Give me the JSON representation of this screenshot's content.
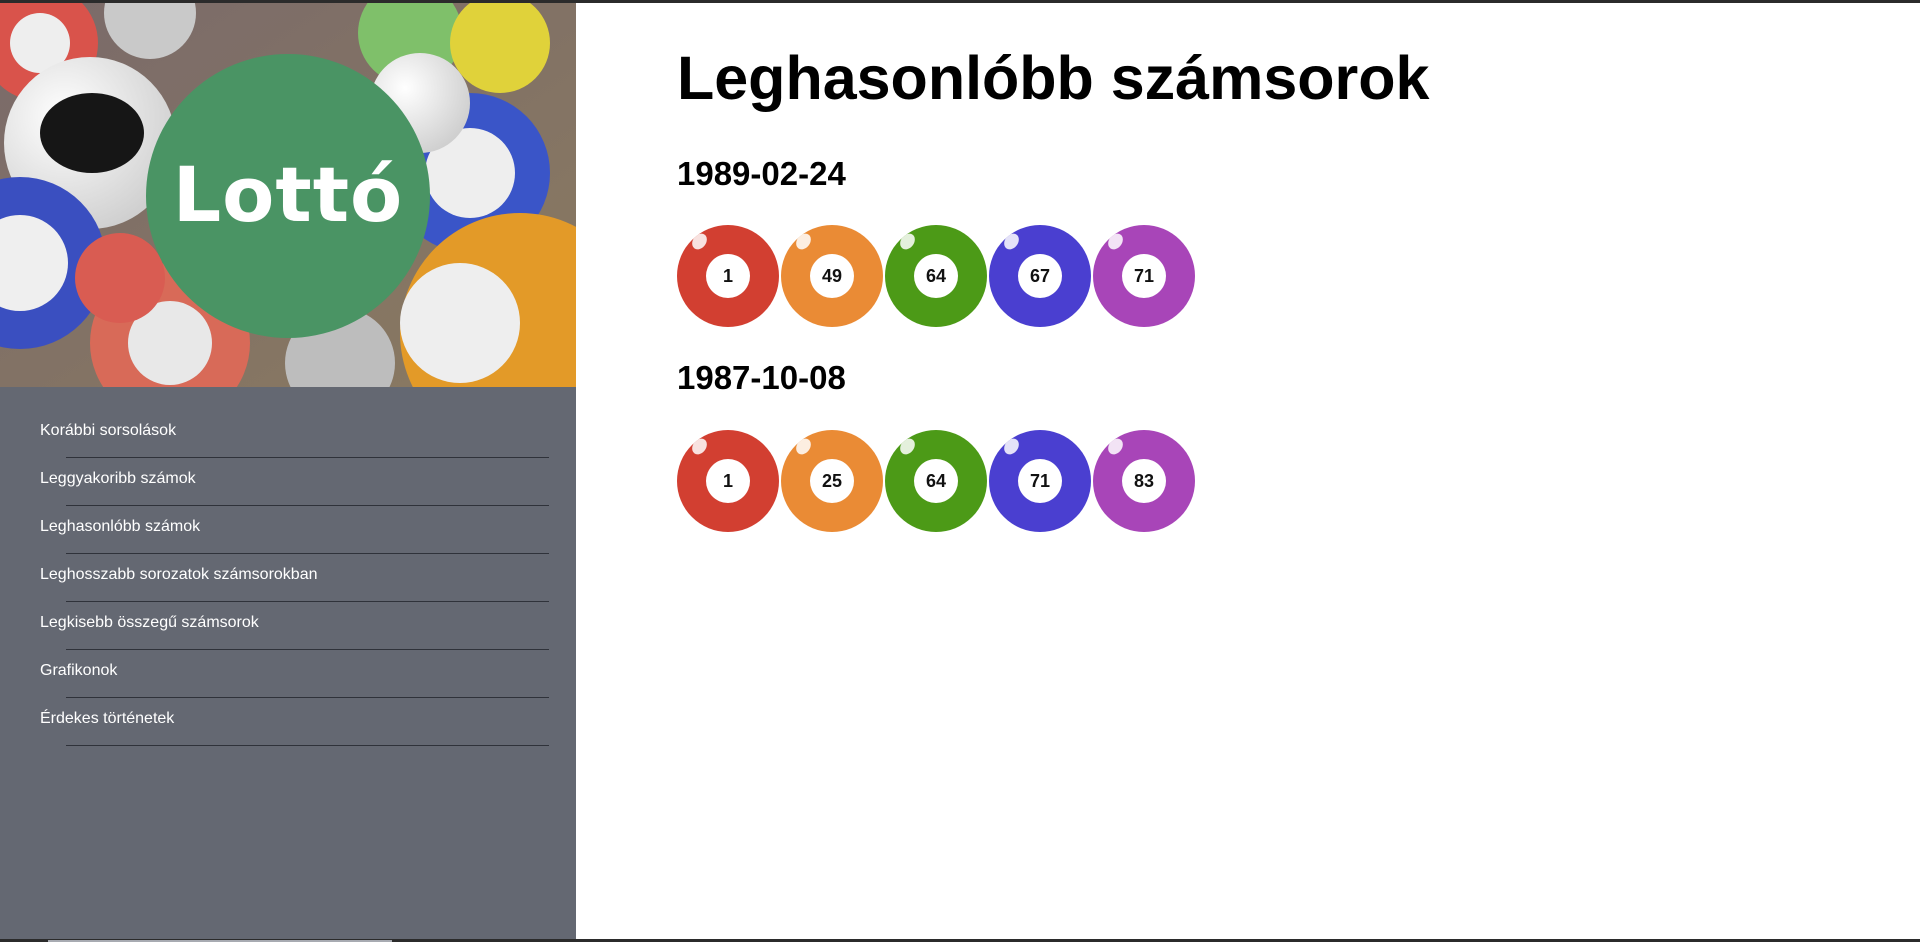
{
  "logo": {
    "text": "Lottó",
    "circle_color": "#4a9464"
  },
  "sidebar": {
    "background_color": "#646872",
    "items": [
      {
        "label": "Korábbi sorsolások"
      },
      {
        "label": "Leggyakoribb számok"
      },
      {
        "label": "Leghasonlóbb számok"
      },
      {
        "label": "Leghosszabb sorozatok számsorokban"
      },
      {
        "label": "Legkisebb összegű számsorok"
      },
      {
        "label": "Grafikonok"
      },
      {
        "label": "Érdekes történetek"
      }
    ]
  },
  "main": {
    "title": "Leghasonlóbb számsorok",
    "draws": [
      {
        "date": "1989-02-24",
        "numbers": [
          "1",
          "49",
          "64",
          "67",
          "71"
        ]
      },
      {
        "date": "1987-10-08",
        "numbers": [
          "1",
          "25",
          "64",
          "71",
          "83"
        ]
      }
    ]
  },
  "ball_colors": [
    "#d23f31",
    "#ea8b35",
    "#4c9a17",
    "#4a3fd0",
    "#a845b8"
  ]
}
